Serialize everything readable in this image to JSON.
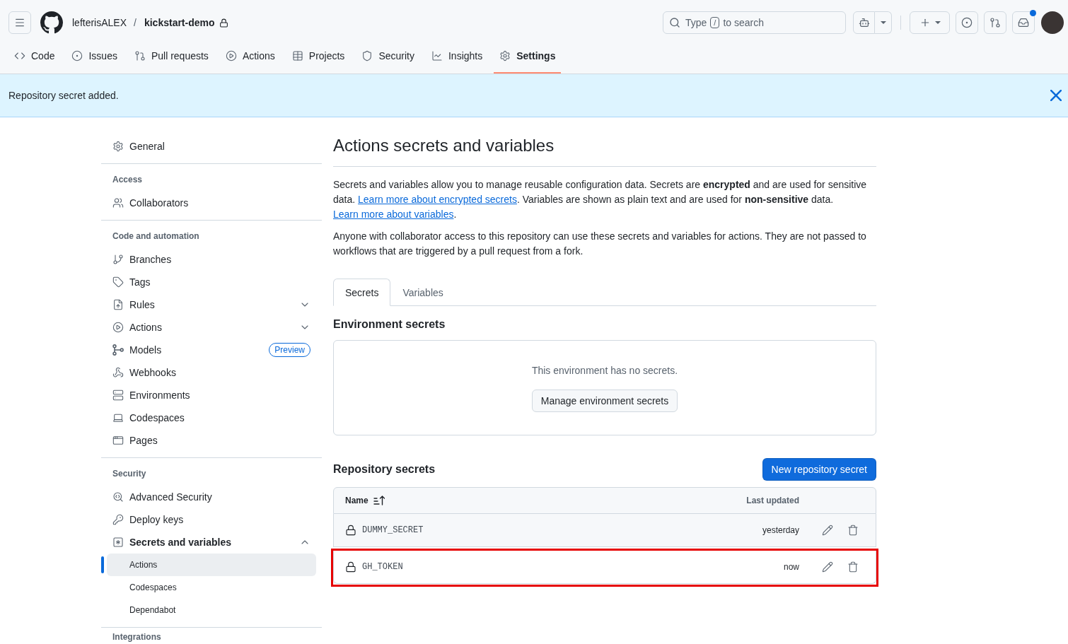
{
  "header": {
    "owner": "lefterisALEX",
    "separator": "/",
    "repo": "kickstart-demo",
    "private": true,
    "search": {
      "hint_start": "Type",
      "shortcut_key": "/",
      "hint_end": "to search"
    },
    "unread_notifications": true
  },
  "repo_nav": [
    {
      "label": "Code",
      "selected": false
    },
    {
      "label": "Issues",
      "selected": false
    },
    {
      "label": "Pull requests",
      "selected": false
    },
    {
      "label": "Actions",
      "selected": false
    },
    {
      "label": "Projects",
      "selected": false
    },
    {
      "label": "Security",
      "selected": false
    },
    {
      "label": "Insights",
      "selected": false
    },
    {
      "label": "Settings",
      "selected": true
    }
  ],
  "flash": {
    "message": "Repository secret added."
  },
  "sidebar": {
    "sections": [
      {
        "items": [
          {
            "label": "General",
            "selected": false
          }
        ]
      },
      {
        "heading": "Access",
        "items": [
          {
            "label": "Collaborators",
            "selected": false
          }
        ]
      },
      {
        "heading": "Code and automation",
        "items": [
          {
            "label": "Branches",
            "selected": false
          },
          {
            "label": "Tags",
            "selected": false
          },
          {
            "label": "Rules",
            "selected": false,
            "expanded": false
          },
          {
            "label": "Actions",
            "selected": false,
            "expanded": false
          },
          {
            "label": "Models",
            "selected": false,
            "badge": "Preview"
          },
          {
            "label": "Webhooks",
            "selected": false
          },
          {
            "label": "Environments",
            "selected": false
          },
          {
            "label": "Codespaces",
            "selected": false
          },
          {
            "label": "Pages",
            "selected": false
          }
        ]
      },
      {
        "heading": "Security",
        "items": [
          {
            "label": "Advanced Security",
            "selected": false
          },
          {
            "label": "Deploy keys",
            "selected": false
          },
          {
            "label": "Secrets and variables",
            "selected": false,
            "expanded": true,
            "children": [
              {
                "label": "Actions",
                "selected": true
              },
              {
                "label": "Codespaces",
                "selected": false
              },
              {
                "label": "Dependabot",
                "selected": false
              }
            ]
          }
        ]
      },
      {
        "heading": "Integrations"
      }
    ]
  },
  "page": {
    "title": "Actions secrets and variables",
    "intro": [
      {
        "kind": "text",
        "text": "Secrets and variables allow you to manage reusable configuration data. Secrets are **encrypted** and are used for sensitive data. "
      },
      {
        "kind": "link",
        "text": "Learn more about encrypted secrets"
      },
      {
        "kind": "text",
        "text": ". Variables are shown as plain text and are used for **non-sensitive** data. "
      },
      {
        "kind": "link",
        "text": "Learn more about variables"
      },
      {
        "kind": "text",
        "text": "."
      }
    ],
    "note": "Anyone with collaborator access to this repository can use these secrets and variables for actions. They are not passed to workflows that are triggered by a pull request from a fork."
  },
  "tabs": [
    {
      "label": "Secrets",
      "selected": true
    },
    {
      "label": "Variables",
      "selected": false
    }
  ],
  "environment_secrets": {
    "heading": "Environment secrets",
    "empty_message": "This environment has no secrets.",
    "button": "Manage environment secrets"
  },
  "repository_secrets": {
    "heading": "Repository secrets",
    "button": "New repository secret",
    "columns": [
      {
        "label": "Name",
        "sorted": true
      },
      {
        "label": "Last updated"
      }
    ],
    "rows": [
      {
        "name": "DUMMY_SECRET",
        "updated": "yesterday",
        "hovered": true,
        "highlighted": false
      },
      {
        "name": "GH_TOKEN",
        "updated": "now",
        "hovered": false,
        "highlighted": true
      }
    ]
  }
}
